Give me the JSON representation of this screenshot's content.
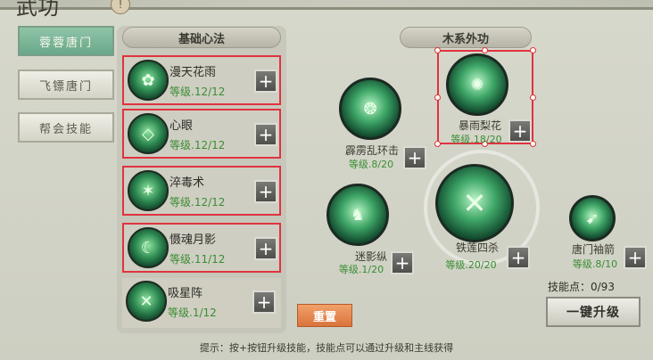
{
  "window": {
    "title_char": "武功",
    "info_label": "!"
  },
  "tabs": [
    {
      "label": "蓉蓉唐门",
      "active": true
    },
    {
      "label": "飞镖唐门",
      "active": false
    },
    {
      "label": "帮会技能",
      "active": false
    }
  ],
  "basic": {
    "header": "基础心法",
    "skills": [
      {
        "name": "漫天花雨",
        "level": "等级.12/12",
        "selected": true,
        "icon": "flower-rain-icon"
      },
      {
        "name": "心眼",
        "level": "等级.12/12",
        "selected": true,
        "icon": "heart-eye-icon"
      },
      {
        "name": "淬毒术",
        "level": "等级.12/12",
        "selected": true,
        "icon": "poison-icon"
      },
      {
        "name": "慑魂月影",
        "level": "等级.11/12",
        "selected": true,
        "icon": "moon-shadow-icon"
      },
      {
        "name": "吸星阵",
        "level": "等级.1/12",
        "selected": false,
        "icon": "star-array-icon"
      }
    ],
    "plus_label": "+"
  },
  "wood": {
    "header": "木系外功",
    "skills": [
      {
        "key": "baoyu",
        "name": "暴雨梨花",
        "level": "等级.18/20",
        "icon": "storm-pear-icon"
      },
      {
        "key": "pili",
        "name": "霹雳乱环击",
        "level": "等级.8/20",
        "icon": "thunder-ring-icon"
      },
      {
        "key": "miying",
        "name": "迷影纵",
        "level": "等级.1/20",
        "icon": "shadow-leap-icon"
      },
      {
        "key": "tielian",
        "name": "铁莲四杀",
        "level": "等级.20/20",
        "icon": "iron-lotus-icon"
      },
      {
        "key": "xiujian",
        "name": "唐门袖箭",
        "level": "等级.8/10",
        "icon": "sleeve-arrow-icon"
      }
    ],
    "plus_label": "+"
  },
  "controls": {
    "reset_label": "重置",
    "points_label": "技能点：0/93",
    "upgrade_label": "一键升级"
  },
  "hint": "提示：按+按钮升级技能，技能点可以通过升级和主线获得"
}
